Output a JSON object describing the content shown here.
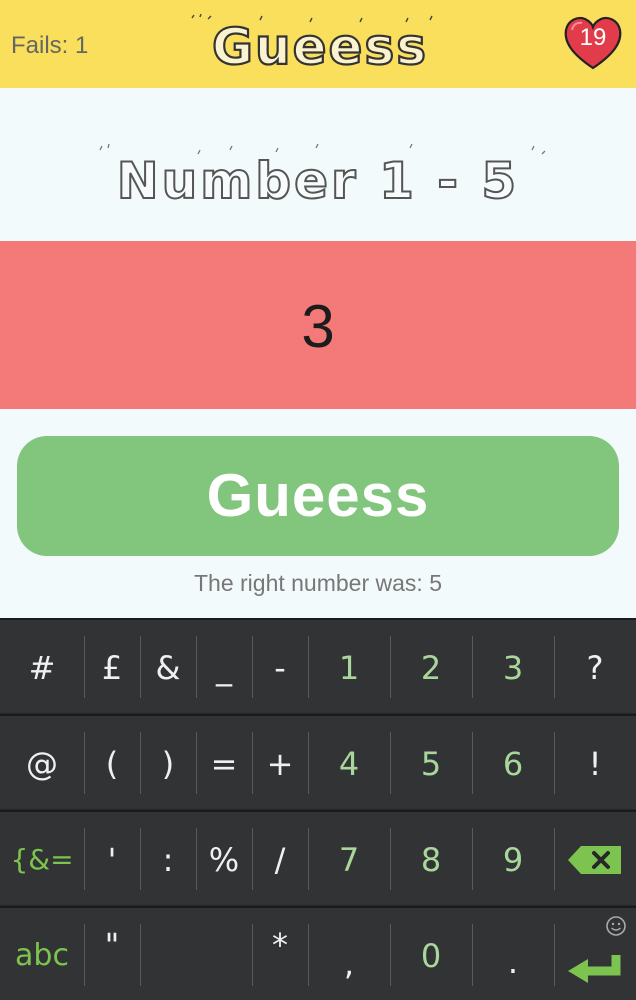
{
  "header": {
    "fails_label": "Fails: 1",
    "app_title": "Gueess",
    "lives_count": "19"
  },
  "subtitle": "Number 1 - 5",
  "guess_input": {
    "value": "3"
  },
  "guess_button": {
    "label": "Gueess"
  },
  "result_text": "The right number was: 5",
  "colors": {
    "header_bg": "#f9df5c",
    "input_bg": "#f47a7a",
    "button_bg": "#82c57d",
    "heart": "#e23c4a",
    "keyboard_bg": "#2c2d2f",
    "keyboard_digit": "#a9d69a",
    "keyboard_accent": "#7cc34f"
  },
  "keyboard": {
    "row1": [
      "#",
      "£",
      "&",
      "_",
      "-",
      "1",
      "2",
      "3",
      "?"
    ],
    "row2": [
      "@",
      "(",
      ")",
      "=",
      "+",
      "4",
      "5",
      "6",
      "!"
    ],
    "row3": [
      "{&=",
      "'",
      ":",
      "%",
      "/",
      "7",
      "8",
      "9"
    ],
    "row4": [
      "abc",
      "\"",
      "*",
      ",",
      "0",
      "."
    ],
    "icons": [
      "backspace-icon",
      "enter-icon",
      "smiley-icon"
    ]
  }
}
